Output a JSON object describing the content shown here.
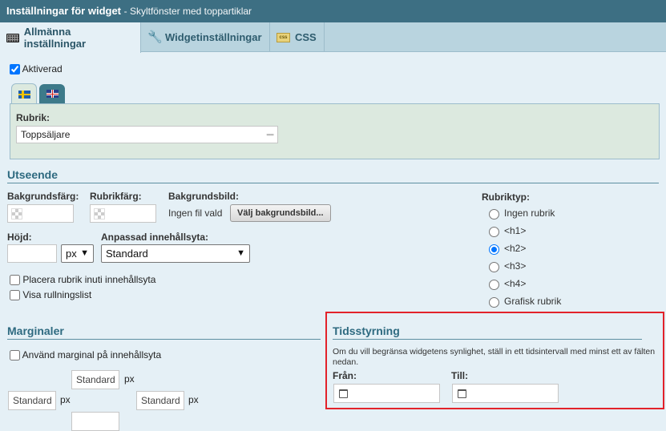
{
  "window": {
    "title": "Inställningar för widget",
    "subtitle": "- Skyltfönster med toppartiklar"
  },
  "tabs": [
    {
      "label": "Allmänna inställningar",
      "icon": "keyboard-icon",
      "active": true
    },
    {
      "label": "Widgetinställningar",
      "icon": "wrench-icon",
      "active": false
    },
    {
      "label": "CSS",
      "icon": "css-file-icon",
      "active": false
    }
  ],
  "general": {
    "enabled_label": "Aktiverad",
    "enabled": true,
    "language_tabs": [
      "swedish-flag-icon",
      "uk-flag-icon"
    ],
    "heading_label": "Rubrik:",
    "heading_value": "Toppsäljare"
  },
  "appearance": {
    "section_title": "Utseende",
    "bg_color_label": "Bakgrundsfärg:",
    "heading_color_label": "Rubrikfärg:",
    "bg_image_label": "Bakgrundsbild:",
    "no_file_text": "Ingen fil vald",
    "choose_bg_button": "Välj bakgrundsbild...",
    "height_label": "Höjd:",
    "height_value": "",
    "unit_value": "px",
    "content_area_label": "Anpassad innehållsyta:",
    "content_area_value": "Standard",
    "place_heading_label": "Placera rubrik inuti innehållsyta",
    "show_scrollbar_label": "Visa rullningslist",
    "heading_type_label": "Rubriktyp:",
    "heading_types": [
      {
        "label": "Ingen rubrik",
        "checked": false
      },
      {
        "label": "<h1>",
        "checked": false
      },
      {
        "label": "<h2>",
        "checked": true
      },
      {
        "label": "<h3>",
        "checked": false
      },
      {
        "label": "<h4>",
        "checked": false
      },
      {
        "label": "Grafisk rubrik",
        "checked": false
      }
    ]
  },
  "margins": {
    "section_title": "Marginaler",
    "use_margin_label": "Använd marginal på innehållsyta",
    "top_placeholder": "Standard",
    "left_placeholder": "Standard",
    "right_placeholder": "Standard",
    "unit": "px"
  },
  "scheduling": {
    "section_title": "Tidsstyrning",
    "description": "Om du vill begränsa widgetens synlighet, ställ in ett tidsintervall med minst ett av fälten nedan.",
    "from_label": "Från:",
    "to_label": "Till:",
    "from_value": "",
    "to_value": ""
  },
  "colors": {
    "titlebar": "#3d6f83",
    "accent": "#2e6a80",
    "highlight_border": "#e2222a"
  }
}
